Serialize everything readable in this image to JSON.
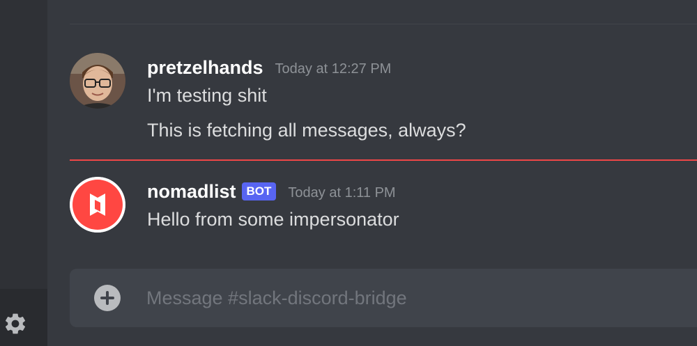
{
  "messages": [
    {
      "username": "pretzelhands",
      "timestamp": "Today at 12:27 PM",
      "lines": [
        "I'm testing shit",
        "This is fetching all messages, always?"
      ]
    },
    {
      "username": "nomadlist",
      "badge": "BOT",
      "timestamp": "Today at 1:11 PM",
      "lines": [
        "Hello from some impersonator"
      ]
    }
  ],
  "composer": {
    "placeholder": "Message #slack-discord-bridge"
  },
  "icons": {
    "settings": "gear-icon",
    "attach": "plus-circle-icon",
    "bot_avatar": "nomadlist-logo-icon"
  },
  "colors": {
    "background": "#36393f",
    "sidebar": "#2f3136",
    "new_messages_divider": "#f04747",
    "bot_badge": "#5865f2",
    "nomadlist_brand": "#ff4742"
  }
}
